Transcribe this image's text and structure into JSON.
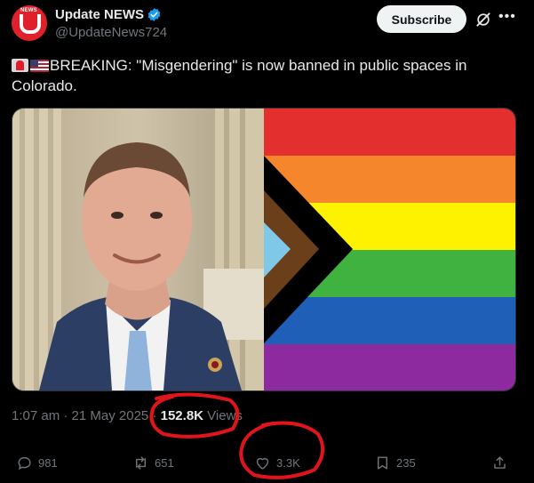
{
  "author": {
    "display_name": "Update NEWS",
    "handle": "@UpdateNews724",
    "avatar_text": "NEWS",
    "verified": true
  },
  "header": {
    "subscribe_label": "Subscribe"
  },
  "tweet": {
    "text": "BREAKING: \"Misgendering\" is now banned in public spaces in Colorado.",
    "emojis": [
      "police-light",
      "us-flag"
    ]
  },
  "meta": {
    "time": "1:07 am",
    "separator": " · ",
    "date": "21 May 2025",
    "views_count": "152.8K",
    "views_label": "Views"
  },
  "actions": {
    "replies": "981",
    "reposts": "651",
    "likes": "3.3K",
    "bookmarks": "235"
  },
  "colors": {
    "background": "#000000",
    "text": "#e7e9ea",
    "muted": "#71767b",
    "verified": "#1d9bf0",
    "annotation": "#e0151c"
  }
}
